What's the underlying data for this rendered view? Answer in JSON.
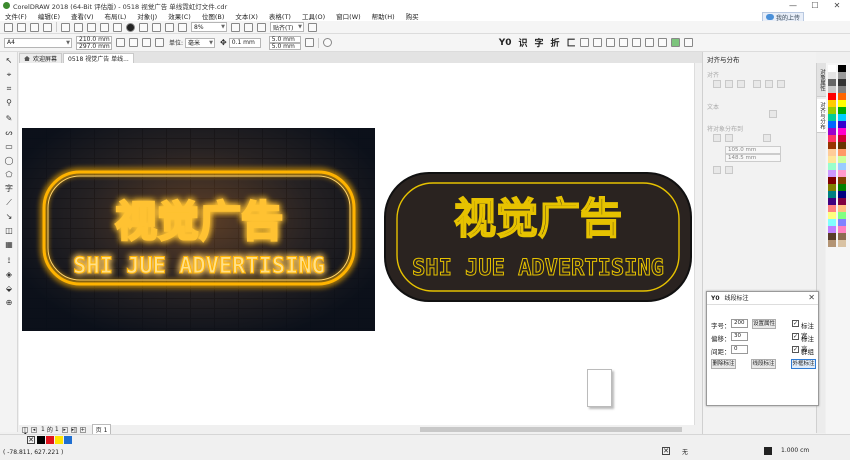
{
  "window": {
    "title": "CorelDRAW 2018 (64-Bit 评估版) - 0518 视觉广告 单线霓虹灯文件.cdr",
    "minimize": "—",
    "maximize": "☐",
    "close": "✕"
  },
  "menu": [
    "文件(F)",
    "编辑(E)",
    "查看(V)",
    "布局(L)",
    "对象(J)",
    "效果(C)",
    "位图(B)",
    "文本(X)",
    "表格(T)",
    "工具(O)",
    "窗口(W)",
    "帮助(H)",
    "购买"
  ],
  "cloud_button": "我的上传",
  "toolbar1": {
    "zoom": "8%",
    "snap": "贴齐(T)"
  },
  "toolbar2": {
    "paper": "A4",
    "width": "210.0 mm",
    "height": "297.0 mm",
    "units_label": "单位:",
    "units": "毫米",
    "nudge": "0.1 mm",
    "dup_x": "5.0 mm",
    "dup_y": "5.0 mm",
    "plugin_glyphs": [
      "Y0",
      "识",
      "字",
      "折",
      "匚"
    ]
  },
  "tabs": [
    {
      "label": "欢迎屏幕",
      "active": false
    },
    {
      "label": "0518 视觉广告 单线...",
      "active": true
    }
  ],
  "artwork": {
    "cn_text": "视觉广告",
    "en_text": "SHI JUE ADVERTISING"
  },
  "page_nav": {
    "current": "1",
    "of": "的",
    "total": "1",
    "page_tab": "页 1"
  },
  "status": {
    "coords": "( -78.811, 627.221 )",
    "fill": "无",
    "outline": "1.000 cm"
  },
  "right_panel": {
    "title": "对齐与分布",
    "section_align": "对齐",
    "section_distribute": "分布",
    "section_text": "文本",
    "section_spacing": "将对象分布到",
    "field_w": "105.0 mm",
    "field_h": "148.5 mm"
  },
  "dock_tabs": [
    "对象属性",
    "对齐与分布"
  ],
  "dialog": {
    "logo": "Y0",
    "title": "线段标注",
    "font_label": "字号：",
    "font_value": "200",
    "set_attr_btn": "设置属性",
    "offset_label": "偏移：",
    "offset_value": "30",
    "spacing_label": "间距：",
    "spacing_value": "0",
    "check1": "标注宽",
    "check2": "标注高",
    "check3": "群组",
    "btn_delete": "删除标注",
    "btn_segment": "线段标注",
    "btn_outer": "外框标注"
  },
  "colors": {
    "neon": "#ffb300",
    "badge_bg": "#2a2320",
    "badge_line": "#e6c200",
    "accent": "#2f7bd4"
  }
}
